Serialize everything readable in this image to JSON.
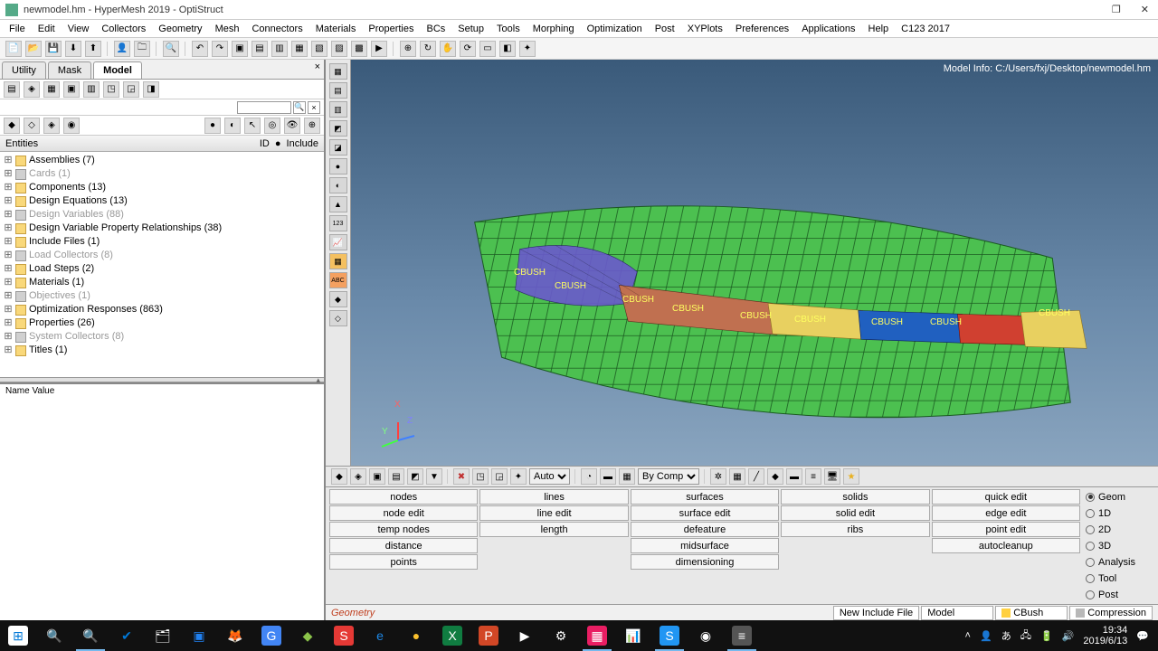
{
  "title": "newmodel.hm - HyperMesh 2019 - OptiStruct",
  "menus": [
    "File",
    "Edit",
    "View",
    "Collectors",
    "Geometry",
    "Mesh",
    "Connectors",
    "Materials",
    "Properties",
    "BCs",
    "Setup",
    "Tools",
    "Morphing",
    "Optimization",
    "Post",
    "XYPlots",
    "Preferences",
    "Applications",
    "Help",
    "C123 2017"
  ],
  "left_tabs": {
    "utility": "Utility",
    "mask": "Mask",
    "model": "Model"
  },
  "tree_header": {
    "entities": "Entities",
    "id": "ID",
    "include": "Include"
  },
  "tree": [
    {
      "label": "Assemblies (7)",
      "gray": false
    },
    {
      "label": "Cards (1)",
      "gray": true
    },
    {
      "label": "Components (13)",
      "gray": false
    },
    {
      "label": "Design Equations (13)",
      "gray": false
    },
    {
      "label": "Design Variables (88)",
      "gray": true
    },
    {
      "label": "Design Variable Property Relationships (38)",
      "gray": false
    },
    {
      "label": "Include Files (1)",
      "gray": false
    },
    {
      "label": "Load Collectors (8)",
      "gray": true
    },
    {
      "label": "Load Steps (2)",
      "gray": false
    },
    {
      "label": "Materials (1)",
      "gray": false
    },
    {
      "label": "Objectives (1)",
      "gray": true
    },
    {
      "label": "Optimization Responses (863)",
      "gray": false
    },
    {
      "label": "Properties (26)",
      "gray": false
    },
    {
      "label": "System Collectors (8)",
      "gray": true
    },
    {
      "label": "Titles (1)",
      "gray": false
    }
  ],
  "name_value": "Name Value",
  "model_info": "Model Info: C:/Users/fxj/Desktop/newmodel.hm",
  "axis": {
    "x": "X",
    "y": "Y",
    "z": "Z"
  },
  "cbush": "CBUSH",
  "autoLabel": "Auto",
  "byComp": "By Comp",
  "panel": {
    "cols": [
      [
        "nodes",
        "node edit",
        "temp nodes",
        "distance",
        "points"
      ],
      [
        "lines",
        "line edit",
        "length",
        "",
        ""
      ],
      [
        "surfaces",
        "surface edit",
        "defeature",
        "midsurface",
        "dimensioning"
      ],
      [
        "solids",
        "solid edit",
        "ribs",
        "",
        ""
      ],
      [
        "quick edit",
        "edge edit",
        "point edit",
        "autocleanup",
        ""
      ]
    ],
    "radios": [
      {
        "label": "Geom",
        "on": true
      },
      {
        "label": "1D",
        "on": false
      },
      {
        "label": "2D",
        "on": false
      },
      {
        "label": "3D",
        "on": false
      },
      {
        "label": "Analysis",
        "on": false
      },
      {
        "label": "Tool",
        "on": false
      },
      {
        "label": "Post",
        "on": false
      }
    ]
  },
  "status": {
    "left": "Geometry",
    "inc": "New Include File",
    "model": "Model",
    "comp": "CBush",
    "comp_color": "#ffd040",
    "comp2": "Compression",
    "comp2_color": "#b8b8b8"
  },
  "tray": {
    "time": "19:34",
    "date": "2019/6/13"
  }
}
